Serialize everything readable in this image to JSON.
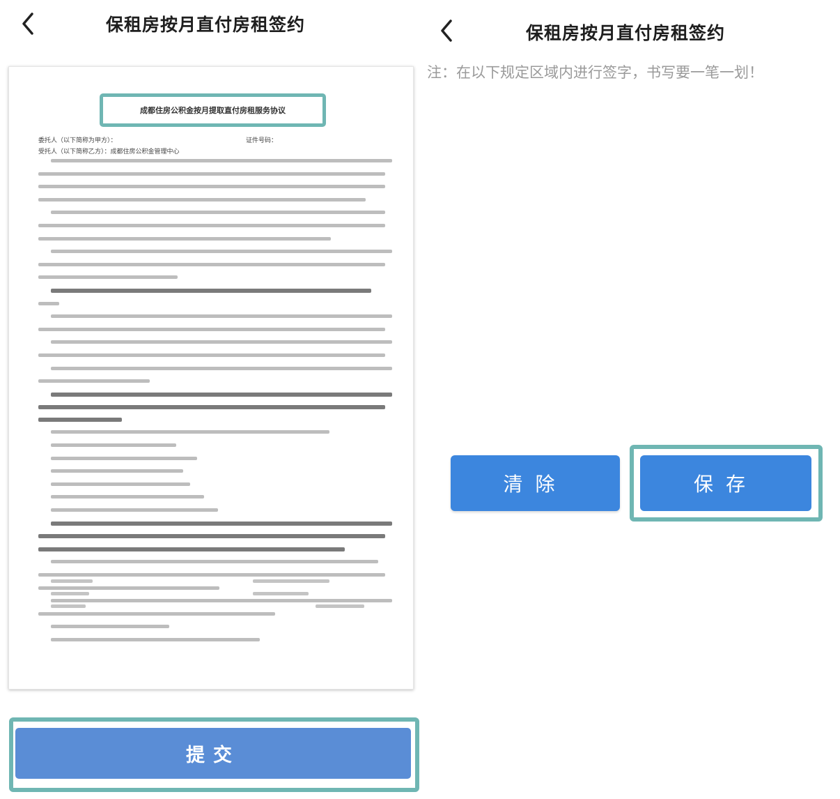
{
  "left": {
    "title": "保租房按月直付房租签约",
    "document": {
      "heading": "成都住房公积金按月提取直付房租服务协议",
      "party_a": "委托人（以下简称为甲方）：",
      "party_b": "受托人（以下简称乙方）：成都住房公积金管理中心",
      "id_label": "证件号码："
    },
    "submit_label": "提交"
  },
  "right": {
    "title": "保租房按月直付房租签约",
    "note": "注：在以下规定区域内进行签字，书写要一笔一划！",
    "clear_label": "清除",
    "save_label": "保存"
  },
  "colors": {
    "highlight": "#6fb6b3",
    "submit_button": "#5a8dd6",
    "action_button": "#3c86de"
  },
  "icons": {
    "back": "chevron-left-icon"
  }
}
